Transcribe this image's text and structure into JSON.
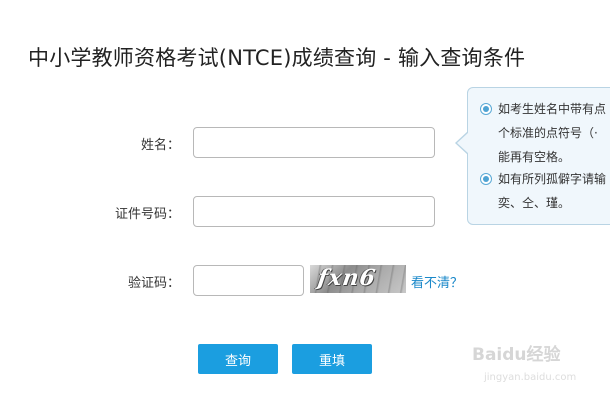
{
  "page": {
    "title": "中小学教师资格考试(NTCE)成绩查询 - 输入查询条件"
  },
  "form": {
    "name_label": "姓名：",
    "name_value": "",
    "id_label": "证件号码：",
    "id_value": "",
    "captcha_label": "验证码：",
    "captcha_value": "",
    "captcha_image_text": "fxn6",
    "refresh_link": "看不清？"
  },
  "buttons": {
    "search": "查询",
    "reset": "重填"
  },
  "tooltip": {
    "items": [
      {
        "lines": [
          "如考生姓名中带有点",
          "个标准的点符号（·",
          "能再有空格。"
        ]
      },
      {
        "lines": [
          "如有所列孤僻字请输",
          "奕、仝、瑾。"
        ]
      }
    ]
  },
  "watermark": {
    "text": "Baidu经验",
    "sub": "jingyan.baidu.com"
  },
  "colors": {
    "accent": "#1b9ee0",
    "link": "#1a88c9",
    "tooltip_bg": "#f0f7fc",
    "tooltip_border": "#b9d4e4"
  }
}
